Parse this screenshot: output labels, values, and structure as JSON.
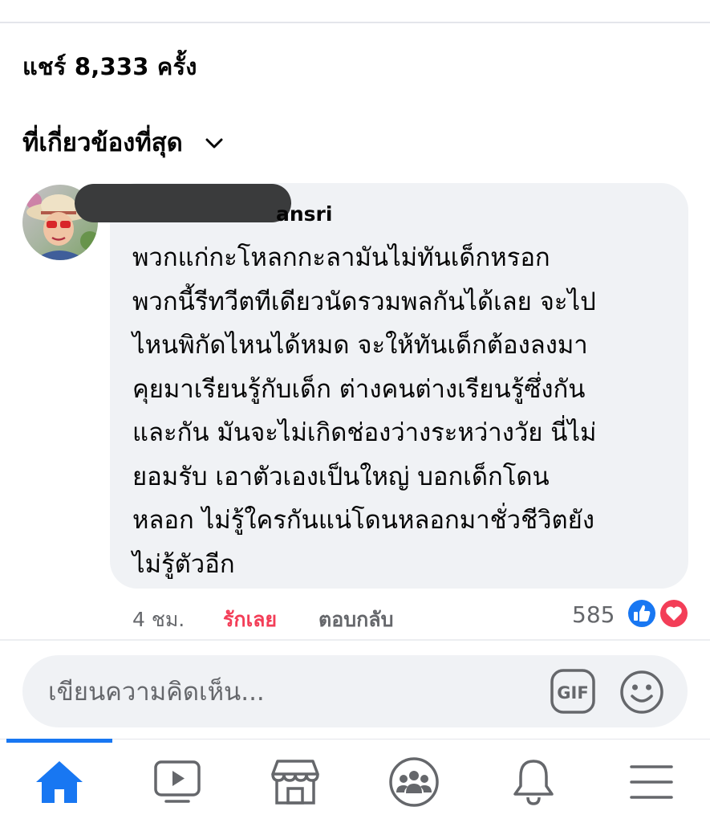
{
  "shares": {
    "text": "แชร์ 8,333 ครั้ง"
  },
  "sort": {
    "label": "ที่เกี่ยวข้องที่สุด"
  },
  "comment": {
    "author_visible": "ansri",
    "text": "พวกแก่กะโหลกกะลามันไม่ทันเด็กหรอก\nพวกนี้รีทวีตทีเดียวนัดรวมพลกันได้เลย จะไป\nไหนพิกัดไหนได้หมด จะให้ทันเด็กต้องลงมา\nคุยมาเรียนรู้กับเด็ก ต่างคนต่างเรียนรู้ซึ่งกัน\nและกัน มันจะไม่เกิดช่องว่างระหว่างวัย นี่ไม่\nยอมรับ เอาตัวเองเป็นใหญ่ บอกเด็กโดน\nหลอก ไม่รู้ใครกันแน่โดนหลอกมาชั่วชีวิตยัง\nไม่รู้ตัวอีก",
    "time": "4 ชม.",
    "love_label": "รักเลย",
    "reply_label": "ตอบกลับ",
    "reaction_count": "585"
  },
  "composer": {
    "placeholder": "เขียนความคิดเห็น...",
    "gif_icon": "GIF"
  },
  "tabs": [
    {
      "icon": "home-icon",
      "active": true
    },
    {
      "icon": "video-icon"
    },
    {
      "icon": "marketplace-icon"
    },
    {
      "icon": "groups-icon"
    },
    {
      "icon": "notifications-icon"
    },
    {
      "icon": "menu-icon"
    }
  ],
  "colors": {
    "accent": "#1877f2",
    "love": "#f33e58",
    "muted": "#65676b",
    "bubble": "#f0f2f5"
  }
}
